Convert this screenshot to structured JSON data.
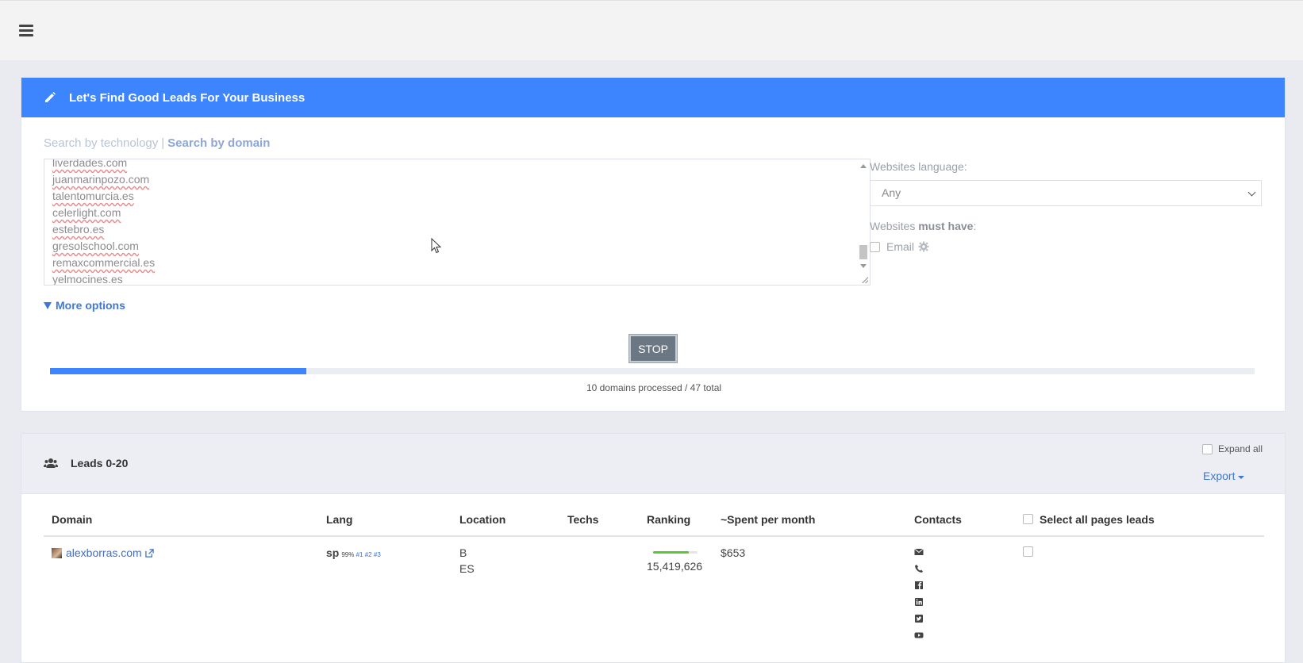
{
  "search": {
    "title": "Let's Find Good Leads For Your Business",
    "mode_tech": "Search by technology",
    "mode_sep": "|",
    "mode_domain": "Search by domain",
    "domains": [
      "liverdades.com",
      "juanmarinpozo.com",
      "talentomurcia.es",
      "celerlight.com",
      "estebro.es",
      "gresolschool.com",
      "remaxcommercial.es",
      "yelmocines.es"
    ],
    "language_label": "Websites language:",
    "language_value": "Any",
    "must_have_prefix": "Websites ",
    "must_have_bold": "must have",
    "must_have_suffix": ":",
    "email_label": "Email",
    "more_options": "More options",
    "stop_label": "STOP",
    "progress_fraction": 0.2128,
    "progress_text": "10 domains processed / 47 total"
  },
  "leads": {
    "title": "Leads 0-20",
    "expand_all": "Expand all",
    "export": "Export",
    "columns": [
      "Domain",
      "Lang",
      "Location",
      "Techs",
      "Ranking",
      "~Spent per month",
      "Contacts",
      "Select all pages leads"
    ],
    "rows": [
      {
        "domain": "alexborras.com",
        "lang": "sp",
        "lang_pct": "99%",
        "lang_tags": [
          "#1",
          "#2",
          "#3"
        ],
        "location_line1": "B",
        "location_line2": "ES",
        "techs": "",
        "ranking": "15,419,626",
        "ranking_fraction": 0.8,
        "spent": "$653",
        "contacts": [
          "envelope-icon",
          "phone-icon",
          "facebook-icon",
          "linkedin-icon",
          "twitter-icon",
          "youtube-icon"
        ]
      }
    ]
  },
  "colors": {
    "accent": "#3d84ff",
    "link": "#3e6fc6",
    "stop_button": "#6c7784",
    "ranking_bar": "#5ac92d"
  }
}
